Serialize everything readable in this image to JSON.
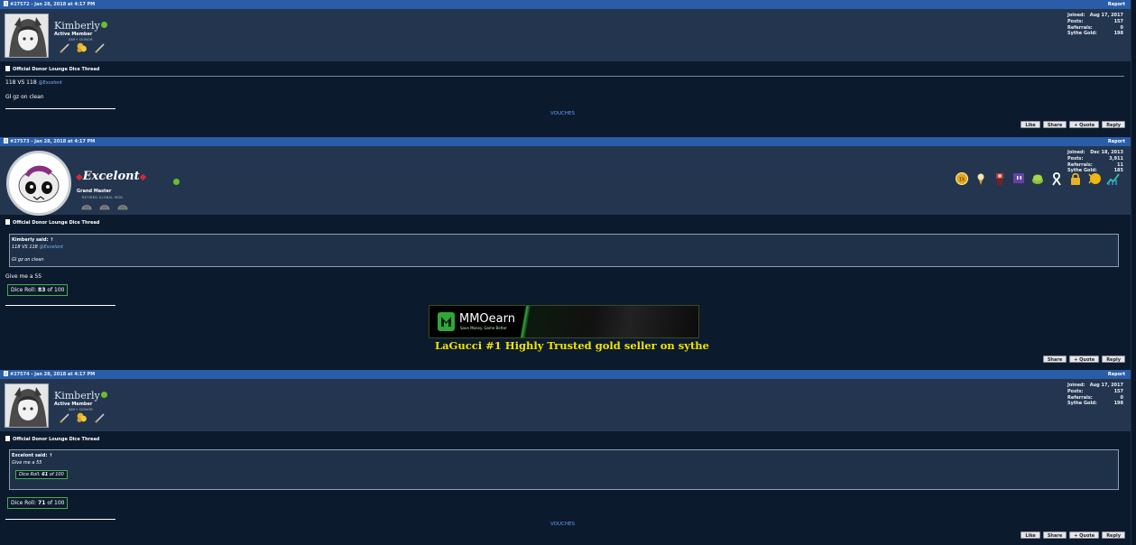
{
  "colors": {
    "page_bg": "#0c1a2e",
    "post_bar": "#2a5da8",
    "userbar": "#24364f",
    "link": "#5ea2f2",
    "ad_caption": "#f2e500",
    "online": "#67c02c",
    "dice_border": "#42b04a"
  },
  "posts": [
    {
      "meta": "#27572 - Jan 28, 2018 at 4:17 PM",
      "report": "Report",
      "username": "Kimberly",
      "user_title": "Active Member",
      "user_sub": "$69+ DONOR",
      "stats": [
        {
          "label": "Joined:",
          "value": "Aug 17, 2017"
        },
        {
          "label": "Posts:",
          "value": "157"
        },
        {
          "label": "Referrals:",
          "value": "0"
        },
        {
          "label": "Sythe Gold:",
          "value": "198"
        }
      ],
      "thread_title": "Official Donor Lounge Dice Thread",
      "line1": "118 VS 118",
      "mention": "@Excelont",
      "line2": "Gl gz on clean",
      "vouches": "VOUCHES",
      "actions": [
        "Like",
        "Share",
        "+ Quote",
        "Reply"
      ]
    },
    {
      "meta": "#27573 - Jan 28, 2018 at 4:17 PM",
      "report": "Report",
      "username": "Excelont",
      "user_title": "Grand Master",
      "user_sub": "RETIRED GLOBAL MOD",
      "stats": [
        {
          "label": "Joined:",
          "value": "Dec 18, 2013"
        },
        {
          "label": "Posts:",
          "value": "3,911"
        },
        {
          "label": "Referrals:",
          "value": "11"
        },
        {
          "label": "Sythe Gold:",
          "value": "185"
        }
      ],
      "thread_title": "Official Donor Lounge Dice Thread",
      "quote_author": "Kimberly said:",
      "quote_arrow": "↑",
      "quote_line1": "118 VS 118",
      "quote_mention": "@Excelont",
      "quote_line2": "Gl gz on clean",
      "body": "Give me a 55",
      "dice_label": "Dice Roll:",
      "dice_value": "83",
      "dice_of": "of 100",
      "ad_brand": "MMOearn",
      "ad_tagline": "Save Money. Game Better",
      "ad_caption": "LaGucci #1 Highly Trusted gold seller on sythe",
      "actions": [
        "Share",
        "+ Quote",
        "Reply"
      ]
    },
    {
      "meta": "#27574 - Jan 28, 2018 at 4:17 PM",
      "report": "Report",
      "username": "Kimberly",
      "user_title": "Active Member",
      "user_sub": "$69+ DONOR",
      "stats": [
        {
          "label": "Joined:",
          "value": "Aug 17, 2017"
        },
        {
          "label": "Posts:",
          "value": "157"
        },
        {
          "label": "Referrals:",
          "value": "0"
        },
        {
          "label": "Sythe Gold:",
          "value": "198"
        }
      ],
      "thread_title": "Official Donor Lounge Dice Thread",
      "quote_author": "Excelont said:",
      "quote_arrow": "↑",
      "quote_line1": "Give me a 55",
      "quote_dice_label": "Dice Roll:",
      "quote_dice_value": "61",
      "quote_dice_of": "of 100",
      "dice_label": "Dice Roll:",
      "dice_value": "71",
      "dice_of": "of 100",
      "vouches": "VOUCHES",
      "actions": [
        "Like",
        "Share",
        "+ Quote",
        "Reply"
      ]
    }
  ]
}
